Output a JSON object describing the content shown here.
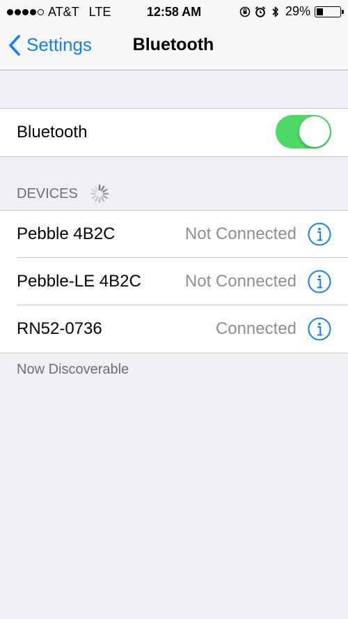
{
  "status_bar": {
    "carrier": "AT&T",
    "network": "LTE",
    "time": "12:58 AM",
    "battery": "29%",
    "signal_bars": 4,
    "signal_total": 5
  },
  "nav": {
    "back_label": "Settings",
    "title": "Bluetooth"
  },
  "bluetooth": {
    "label": "Bluetooth",
    "enabled": true
  },
  "devices": {
    "header": "DEVICES",
    "items": [
      {
        "name": "Pebble 4B2C",
        "status": "Not Connected"
      },
      {
        "name": "Pebble-LE 4B2C",
        "status": "Not Connected"
      },
      {
        "name": "RN52-0736",
        "status": "Connected"
      }
    ],
    "footer": "Now Discoverable"
  },
  "colors": {
    "accent": "#157efb",
    "toggle_on": "#4cd964",
    "background": "#efeff4"
  }
}
